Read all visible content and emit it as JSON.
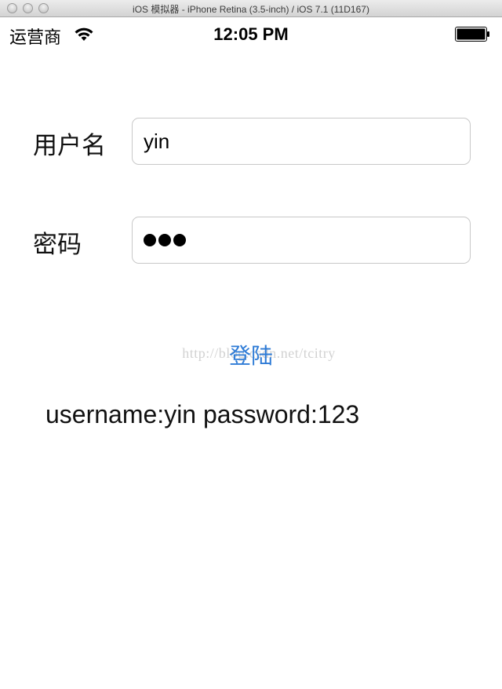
{
  "window": {
    "title": "iOS 模拟器 - iPhone Retina (3.5-inch) / iOS 7.1 (11D167)"
  },
  "status_bar": {
    "carrier": "运营商",
    "time": "12:05 PM",
    "icons": [
      "wifi-icon",
      "battery-icon"
    ]
  },
  "form": {
    "username_label": "用户名",
    "username_value": "yin",
    "password_label": "密码",
    "password_masked_length": 3
  },
  "login_button_label": "登陆",
  "watermark": "http://blog.csdn.net/tcitry",
  "result_text": "username:yin password:123",
  "colors": {
    "accent": "#2e7bd6",
    "field_border": "#c8c8c8",
    "background": "#ffffff"
  }
}
